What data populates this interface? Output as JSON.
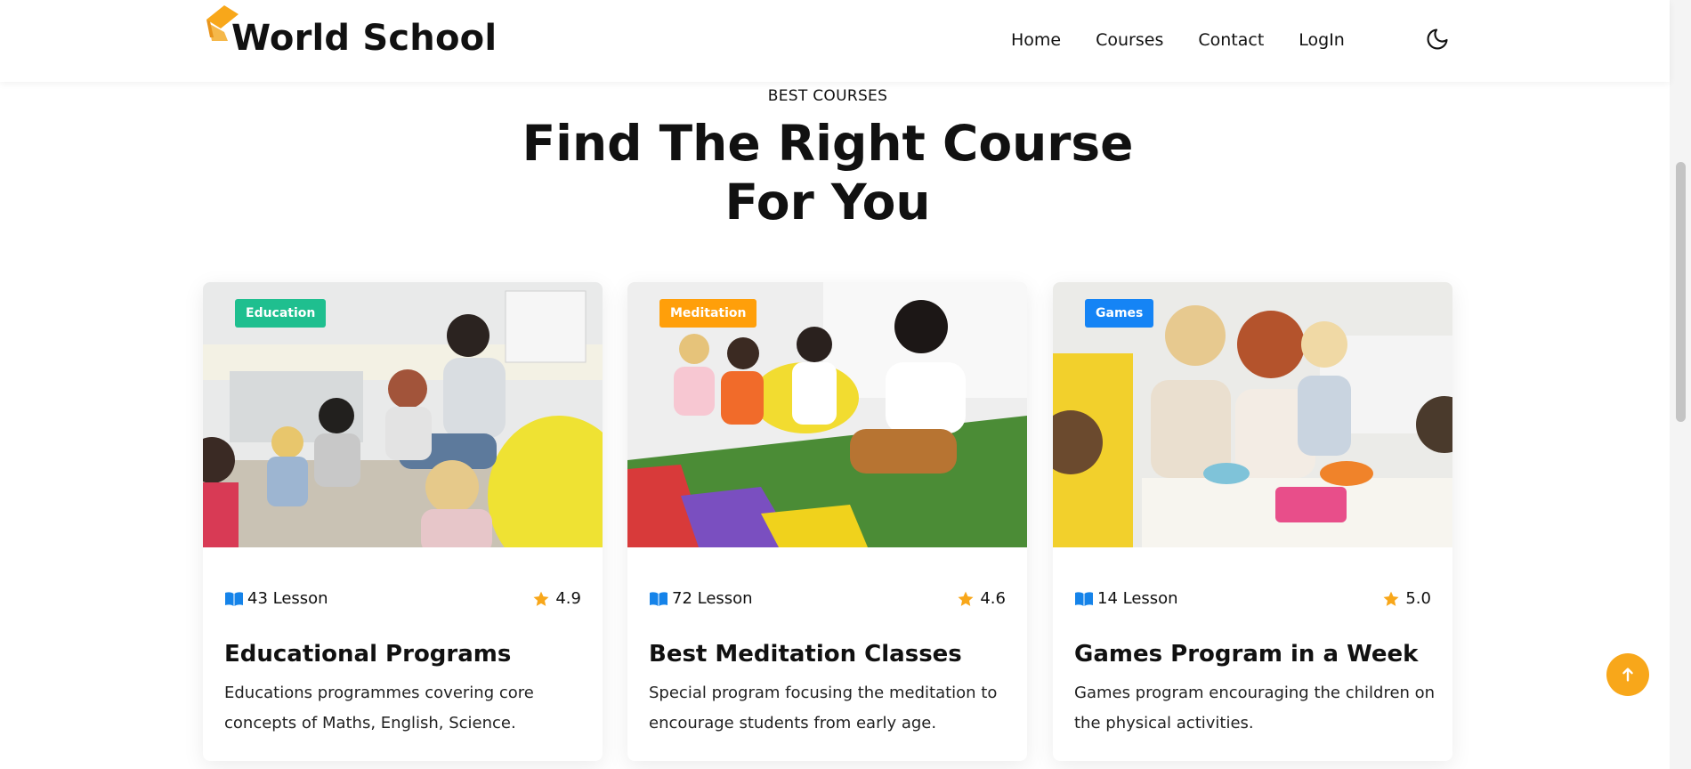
{
  "header": {
    "brand": "World School",
    "nav": [
      {
        "label": "Home"
      },
      {
        "label": "Courses"
      },
      {
        "label": "Contact"
      },
      {
        "label": "LogIn"
      }
    ],
    "theme_icon": "moon-icon"
  },
  "section": {
    "kicker": "BEST COURSES",
    "title_line1": "Find The Right Course",
    "title_line2": "For You"
  },
  "colors": {
    "accent": "#f8a71a",
    "education": "#1fbf8f",
    "meditation": "#ff9f0a",
    "games": "#1584f5",
    "book_icon": "#1583e9",
    "star": "#f8a71a"
  },
  "courses": [
    {
      "badge": "Education",
      "lessons": "43 Lesson",
      "rating": "4.9",
      "title": "Educational Programs",
      "description": "Educations programmes covering core concepts of Maths, English, Science."
    },
    {
      "badge": "Meditation",
      "lessons": "72 Lesson",
      "rating": "4.6",
      "title": "Best Meditation Classes",
      "description": "Special program focusing the meditation to encourage students from early age."
    },
    {
      "badge": "Games",
      "lessons": "14 Lesson",
      "rating": "5.0",
      "title": "Games Program in a Week",
      "description": "Games program encouraging the children on the physical activities."
    }
  ]
}
